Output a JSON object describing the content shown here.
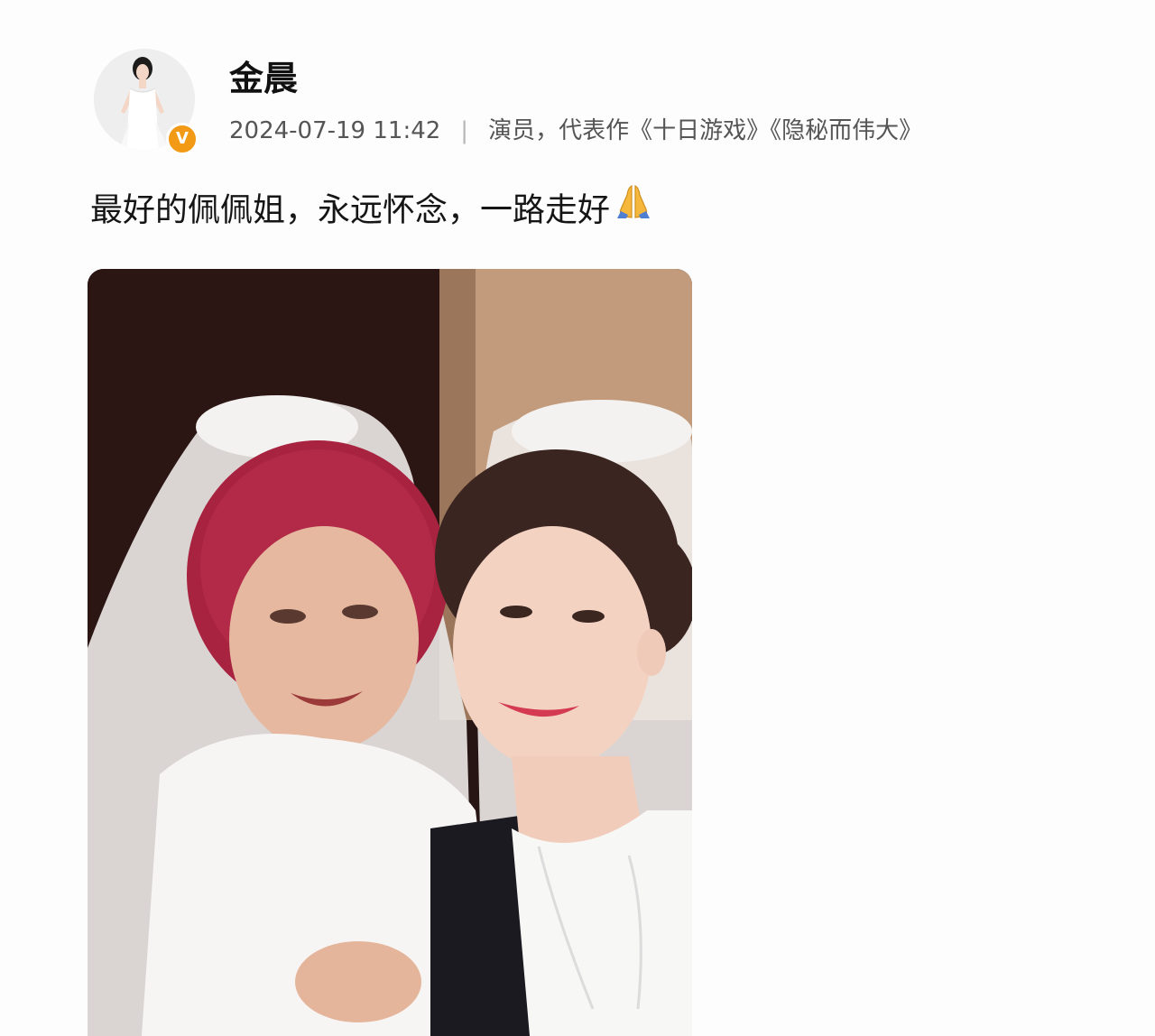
{
  "post": {
    "author": {
      "name": "金晨",
      "verified_badge_text": "V",
      "avatar_icon": "avatar-bride-icon"
    },
    "timestamp": "2024-07-19 11:42",
    "separator": "|",
    "bio": "演员，代表作《十日游戏》《隐秘而伟大》",
    "text": "最好的佩佩姐，永远怀念，一路走好",
    "emoji_icon": "praying-hands-icon",
    "photo_icon": "wedding-photo-two-brides"
  },
  "colors": {
    "badge": "#f29a15",
    "hair_red": "#a8233f",
    "background": "#fdfdfd"
  }
}
